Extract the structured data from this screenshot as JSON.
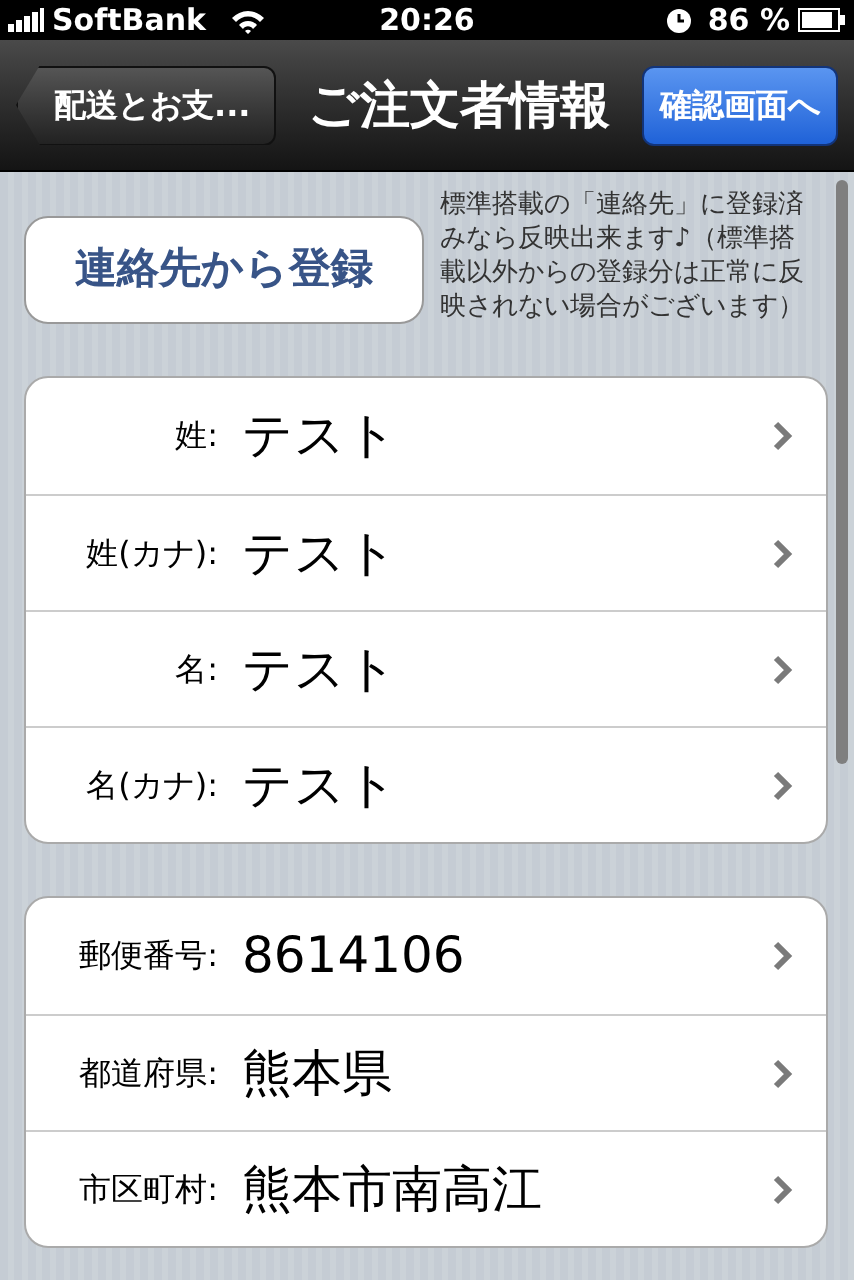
{
  "status_bar": {
    "carrier": "SoftBank",
    "time": "20:26",
    "battery": "86 %"
  },
  "nav": {
    "back": "配送とお支...",
    "title": "ご注文者情報",
    "action": "確認画面へ"
  },
  "import_button": "連絡先から登録",
  "note": "標準搭載の「連絡先」に登録済みなら反映出来ます♪（標準搭載以外からの登録分は正常に反映されない場合がございます）",
  "groups": [
    {
      "rows": [
        {
          "label": "姓:",
          "value": "テスト"
        },
        {
          "label": "姓(カナ):",
          "value": "テスト"
        },
        {
          "label": "名:",
          "value": "テスト"
        },
        {
          "label": "名(カナ):",
          "value": "テスト"
        }
      ]
    },
    {
      "rows": [
        {
          "label": "郵便番号:",
          "value": "8614106"
        },
        {
          "label": "都道府県:",
          "value": "熊本県"
        },
        {
          "label": "市区町村:",
          "value": "熊本市南高江"
        }
      ]
    }
  ]
}
